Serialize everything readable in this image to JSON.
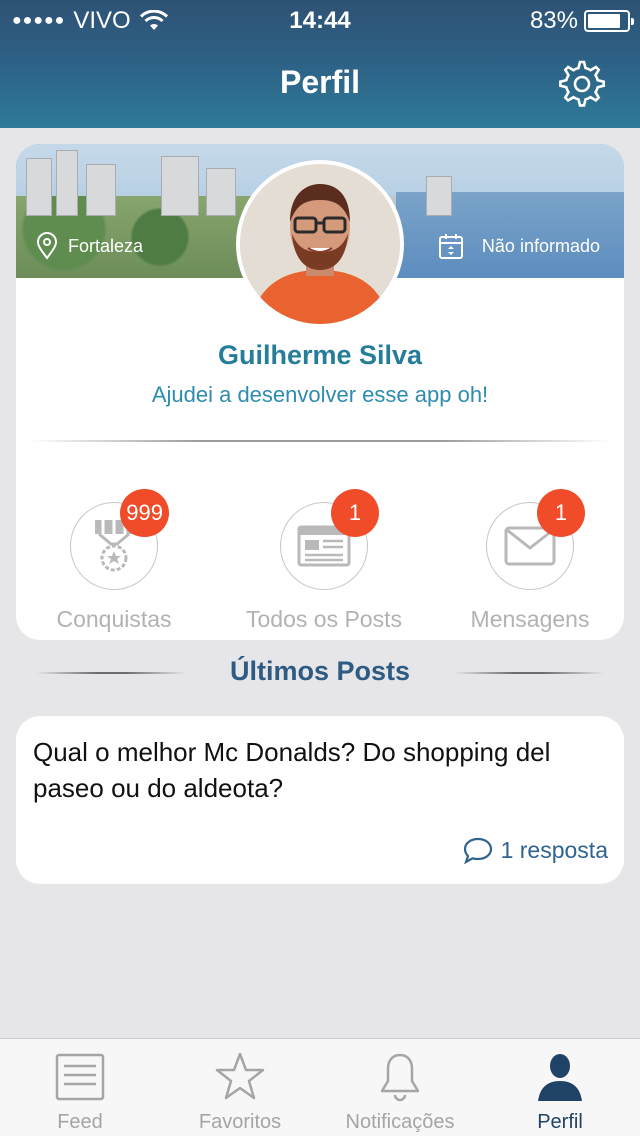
{
  "status_bar": {
    "carrier": "VIVO",
    "signal_dots": "●●●●●",
    "time": "14:44",
    "battery_percent": "83%",
    "battery_level": 0.83
  },
  "header": {
    "title": "Perfil",
    "settings_icon": "gear-icon"
  },
  "profile": {
    "location": "Fortaleza",
    "birthdate": "Não informado",
    "name": "Guilherme Silva",
    "bio": "Ajudei a desenvolver esse app oh!"
  },
  "stats": [
    {
      "label": "Conquistas",
      "badge": "999",
      "icon": "medal-icon"
    },
    {
      "label": "Todos os Posts",
      "badge": "1",
      "icon": "newspaper-icon"
    },
    {
      "label": "Mensagens",
      "badge": "1",
      "icon": "envelope-icon"
    }
  ],
  "latest_posts": {
    "title": "Últimos Posts",
    "items": [
      {
        "text": "Qual o melhor Mc Donalds? Do shopping del paseo ou do aldeota?",
        "replies": "1 resposta"
      }
    ]
  },
  "tabbar": {
    "active": "Perfil",
    "items": [
      {
        "label": "Feed",
        "icon": "feed-icon"
      },
      {
        "label": "Favoritos",
        "icon": "star-icon"
      },
      {
        "label": "Notificações",
        "icon": "bell-icon"
      },
      {
        "label": "Perfil",
        "icon": "person-icon"
      }
    ]
  },
  "colors": {
    "header": "#2d6488",
    "name": "#267d99",
    "badge": "#f04c2a",
    "active_tab": "#1f4266"
  }
}
